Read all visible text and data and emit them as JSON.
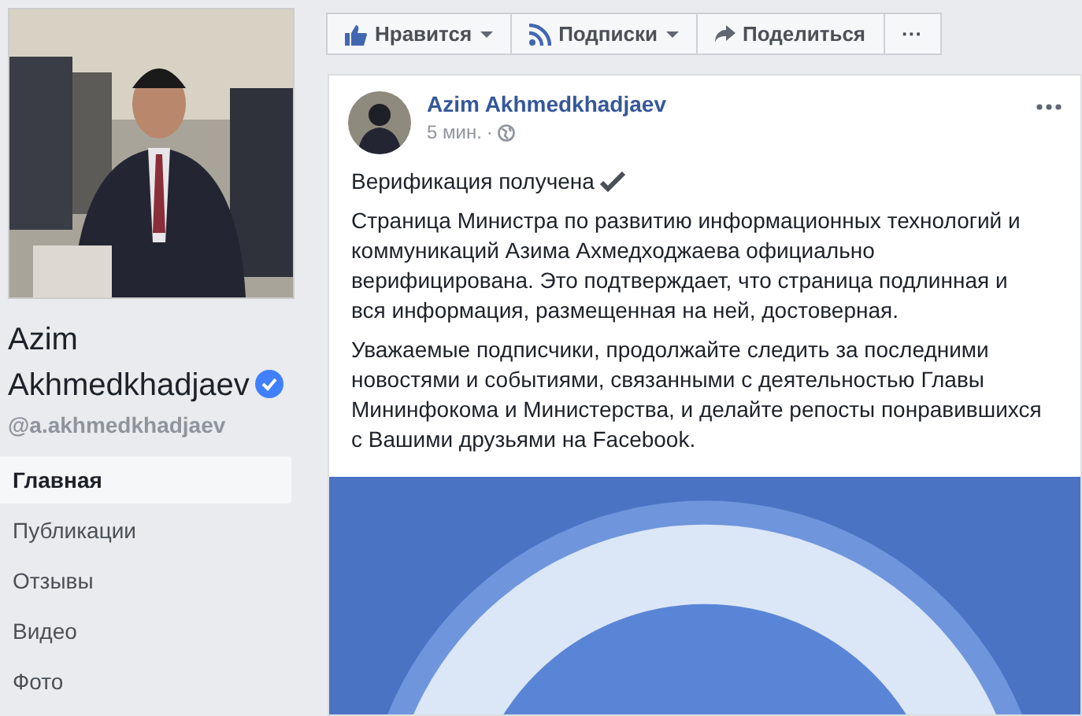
{
  "profile": {
    "name": "Azim Akhmedkhadjaev",
    "verified": true,
    "handle": "@a.akhmedkhadjaev"
  },
  "nav": [
    {
      "label": "Главная",
      "selected": true
    },
    {
      "label": "Публикации",
      "selected": false
    },
    {
      "label": "Отзывы",
      "selected": false
    },
    {
      "label": "Видео",
      "selected": false
    },
    {
      "label": "Фото",
      "selected": false
    }
  ],
  "actions": [
    {
      "kind": "like",
      "label": "Нравится",
      "dropdown": true
    },
    {
      "kind": "follow",
      "label": "Подписки",
      "dropdown": true
    },
    {
      "kind": "share",
      "label": "Поделиться",
      "dropdown": false
    },
    {
      "kind": "more",
      "label": "···",
      "dropdown": false
    }
  ],
  "post": {
    "author": "Azim Akhmedkhadjaev",
    "time": "5 мин.",
    "separator": "·",
    "title": "Верификация получена",
    "paragraphs": [
      "Страница Министра по развитию информационных технологий и коммуникаций Азима Ахмедходжаева официально верифицирована. Это подтверждает, что страница подлинная и вся информация, размещенная на ней, достоверная.",
      "Уважаемые подписчики, продолжайте следить за последними новостями и событиями, связанными с деятельностью Главы Мининфокома и Министерства, и делайте репосты понравившихся с Вашими друзьями на Facebook."
    ]
  }
}
